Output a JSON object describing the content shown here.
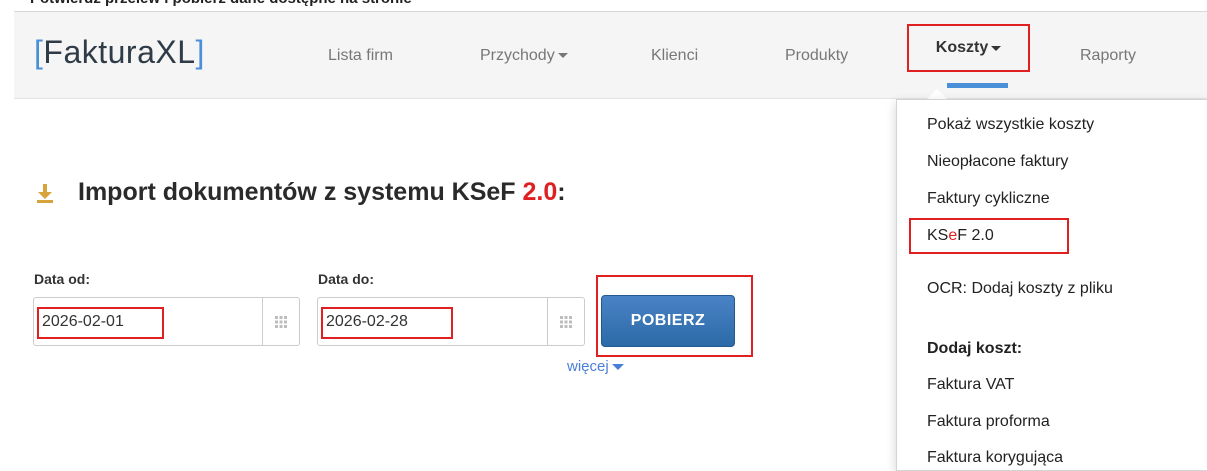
{
  "caption": "Potwierdź przelew i pobierz dane dostępne na stronie",
  "navbar": {
    "brand_open": "[",
    "brand_name": "FakturaXL",
    "brand_close": "]",
    "items": [
      "Lista firm",
      "Przychody",
      "Klienci",
      "Produkty",
      "Koszty",
      "Raporty"
    ]
  },
  "dropdown": {
    "items": [
      "Pokaż wszystkie koszty",
      "Nieopłacone faktury",
      "Faktury cykliczne",
      "OCR: Dodaj koszty z pliku",
      "Faktura VAT",
      "Faktura proforma",
      "Faktura korygująca"
    ],
    "ksef": {
      "prefix": "KS",
      "accent": "e",
      "suffix": "F 2.0"
    },
    "header": "Dodaj koszt:"
  },
  "heading": {
    "text": "Import dokumentów z systemu KSeF ",
    "version": "2.0",
    "suffix": ":"
  },
  "form": {
    "from_label": "Data od:",
    "from_value": "2026-02-01",
    "to_label": "Data do:",
    "to_value": "2026-02-28",
    "submit_label": "POBIERZ",
    "more_label": "więcej"
  },
  "colors": {
    "accent": "#4a90d9",
    "highlight": "#e02020",
    "button": "#2c6aa7"
  }
}
